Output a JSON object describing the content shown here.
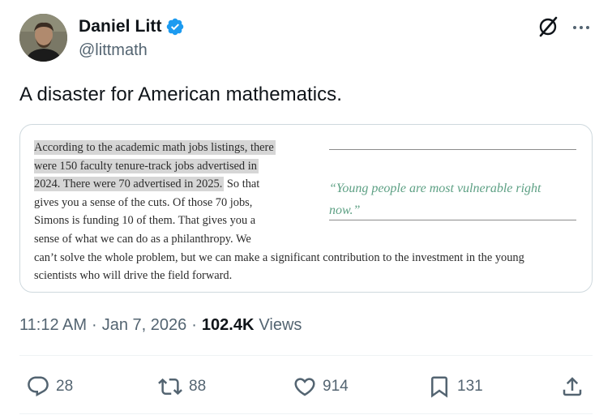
{
  "author": {
    "display_name": "Daniel Litt",
    "handle": "@littmath",
    "verified": true,
    "avatar_icon": "avatar-photo"
  },
  "tweet": {
    "text": "A disaster for American mathematics."
  },
  "media": {
    "article_lines": [
      {
        "hl": "According to the academic math jobs listings, there",
        "rest": ""
      },
      {
        "hl": "were 150 faculty tenure-track jobs advertised in",
        "rest": ""
      },
      {
        "hl": "2024. There were 70 advertised in 2025.",
        "rest": " So that"
      },
      {
        "hl": "",
        "rest": "gives you a sense of the cuts. Of those 70 jobs,"
      },
      {
        "hl": "",
        "rest": "Simons is funding 10 of them. That gives you a"
      },
      {
        "hl": "",
        "rest": "sense of what we can do as a philanthropy. We"
      },
      {
        "hl": "",
        "rest": "can’t solve the whole problem, but we can make a significant contribution to the investment in the young"
      },
      {
        "hl": "",
        "rest": "scientists who will drive the field forward."
      }
    ],
    "pull_quote": "“Young people are most vulnerable right now.”",
    "highlight_color": "#d6d6d6",
    "quote_color": "#5da084"
  },
  "meta": {
    "time": "11:12 AM",
    "separator": "·",
    "date": "Jan 7, 2026",
    "views_count": "102.4K",
    "views_label": "Views"
  },
  "actions": {
    "replies": "28",
    "reposts": "88",
    "likes": "914",
    "bookmarks": "131"
  },
  "icons": {
    "verified": "verified-badge-icon",
    "grok": "grok-icon",
    "more": "more-icon",
    "reply": "reply-icon",
    "repost": "repost-icon",
    "like": "heart-icon",
    "bookmark": "bookmark-icon",
    "share": "share-icon"
  },
  "colors": {
    "text": "#0f1419",
    "secondary": "#536471",
    "verified": "#1d9bf0",
    "border": "#cfd9de"
  }
}
